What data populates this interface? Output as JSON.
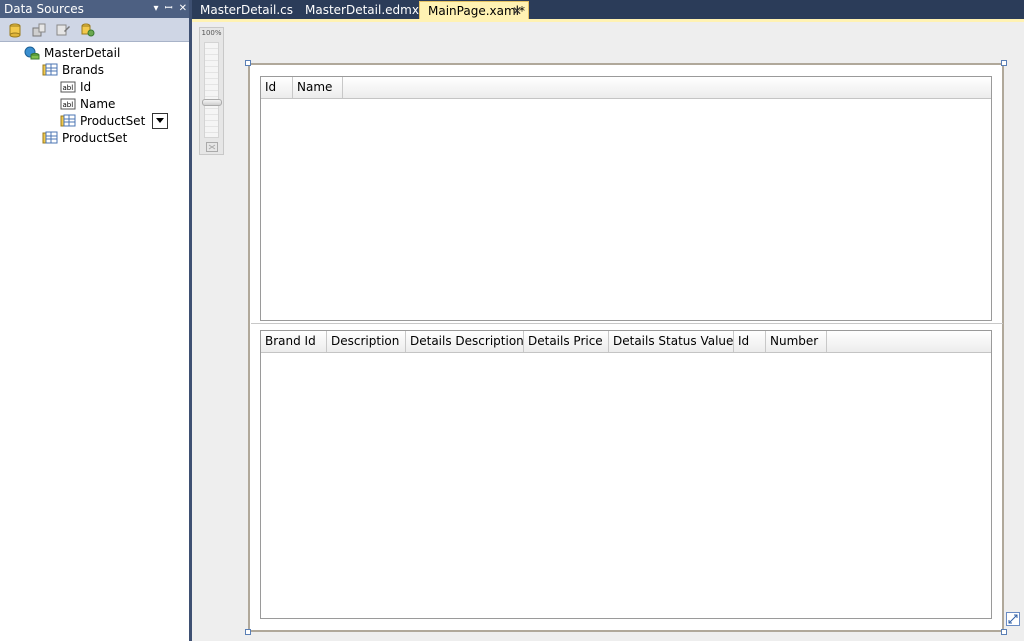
{
  "data_sources": {
    "title": "Data Sources",
    "title_buttons": [
      "▾",
      "ꟷ",
      "✕"
    ],
    "tree": [
      {
        "label": "MasterDetail",
        "icon": "datasource-icon"
      },
      {
        "label": "Brands",
        "icon": "table-icon"
      },
      {
        "label": "Id",
        "icon": "textbox-icon"
      },
      {
        "label": "Name",
        "icon": "textbox-icon"
      },
      {
        "label": "ProductSet",
        "icon": "table-icon"
      },
      {
        "label": "ProductSet",
        "icon": "table-icon"
      }
    ],
    "toolbar_icons": [
      "add-datasource-icon",
      "edit-datasource-icon",
      "configure-datasource-icon",
      "refresh-datasource-icon"
    ]
  },
  "tabs": [
    {
      "label": "MasterDetail.cs",
      "active": false
    },
    {
      "label": "MasterDetail.edmx",
      "active": false
    },
    {
      "label": "MainPage.xaml*",
      "active": true
    }
  ],
  "tab_close": "✕",
  "zoom": {
    "label": "100%"
  },
  "grids": {
    "master": {
      "columns": [
        "Id",
        "Name"
      ]
    },
    "detail": {
      "columns": [
        "Brand Id",
        "Description",
        "Details Description",
        "Details Price",
        "Details Status Value",
        "Id",
        "Number"
      ]
    }
  },
  "colors": {
    "titlebar": "#4d6082",
    "toolbar": "#cfd6e5",
    "active_tab": "#fff2b3",
    "frame": "#2b3c59"
  }
}
